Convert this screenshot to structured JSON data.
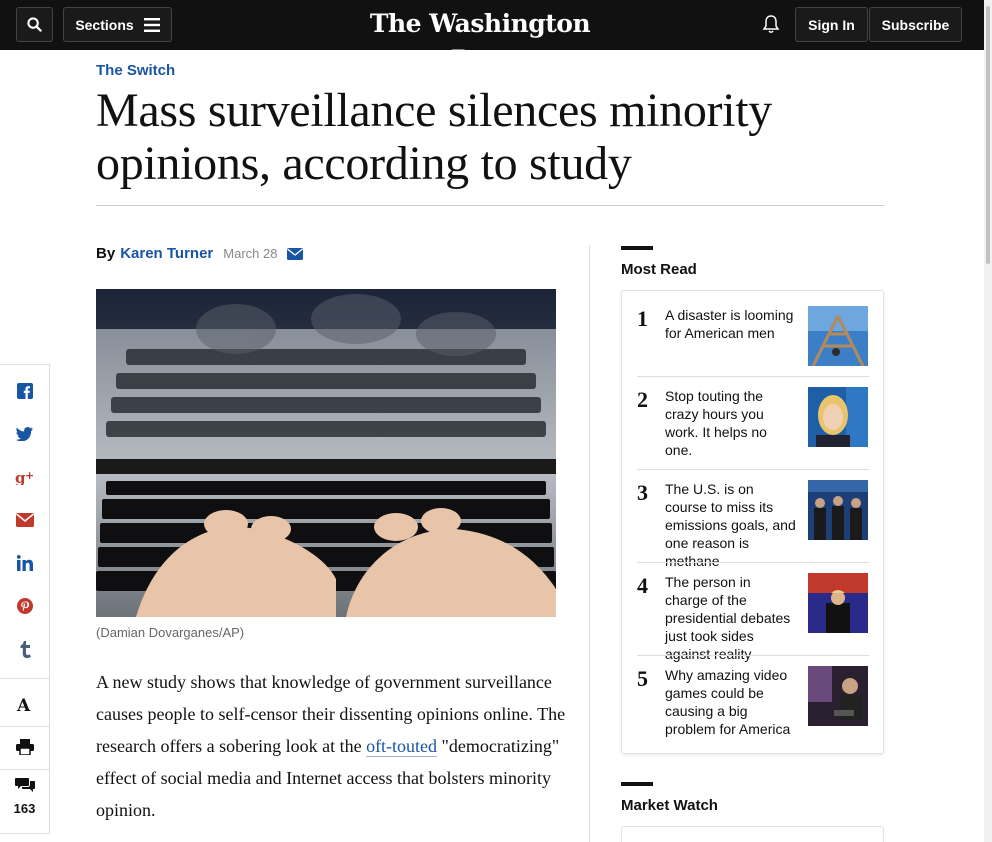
{
  "header": {
    "sections_label": "Sections",
    "masthead": "The Washington Post",
    "signin_label": "Sign In",
    "subscribe_label": "Subscribe"
  },
  "article": {
    "kicker": "The Switch",
    "headline": "Mass surveillance silences minority opinions, according to study",
    "by": "By",
    "author": "Karen Turner",
    "date": "March 28",
    "caption": "(Damian Dovarganes/AP)",
    "body_before": "A new study shows that knowledge of government surveillance causes people to self-censor their dissenting opinions online. The research offers a sobering look at the ",
    "body_link": "oft-touted",
    "body_after": " \"democratizing\" effect of social media and Internet access that bolsters minority opinion."
  },
  "share": {
    "comment_count": "163"
  },
  "most_read": {
    "title": "Most Read",
    "items": [
      {
        "num": "1",
        "text": "A disaster is looming for American men"
      },
      {
        "num": "2",
        "text": "Stop touting the crazy hours you work. It helps no one."
      },
      {
        "num": "3",
        "text": "The U.S. is on course to miss its emissions goals, and one reason is methane"
      },
      {
        "num": "4",
        "text": "The person in charge of the presidential debates just took sides against reality"
      },
      {
        "num": "5",
        "text": "Why amazing video games could be causing a big problem for America"
      }
    ]
  },
  "market_watch": {
    "title": "Market Watch"
  },
  "colors": {
    "link_blue": "#1955a5",
    "topbar": "#111111"
  }
}
